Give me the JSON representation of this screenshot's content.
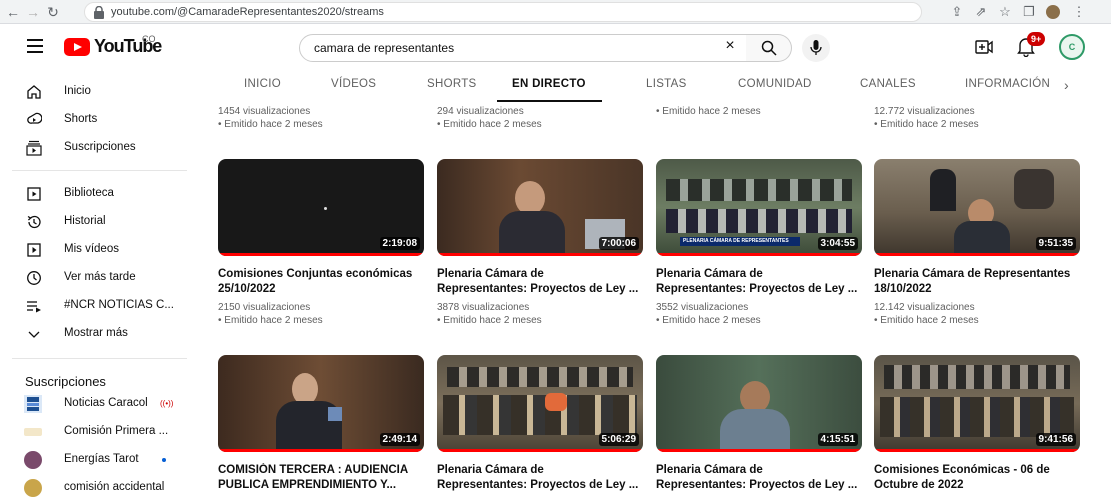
{
  "browser": {
    "url": "youtube.com/@CamaradeRepresentantes2020/streams"
  },
  "header": {
    "logo_text": "YouTube",
    "country_code": "CO",
    "search_value": "camara de representantes",
    "notification_count": "9+",
    "avatar_text": "C"
  },
  "sidebar": {
    "items": [
      {
        "label": "Inicio",
        "icon": "home-icon"
      },
      {
        "label": "Shorts",
        "icon": "shorts-icon"
      },
      {
        "label": "Suscripciones",
        "icon": "subscriptions-icon"
      },
      {
        "label": "Biblioteca",
        "icon": "library-icon"
      },
      {
        "label": "Historial",
        "icon": "history-icon"
      },
      {
        "label": "Mis vídeos",
        "icon": "my-videos-icon"
      },
      {
        "label": "Ver más tarde",
        "icon": "watch-later-icon"
      },
      {
        "label": "#NCR NOTICIAS C...",
        "icon": "playlist-icon"
      },
      {
        "label": "Mostrar más",
        "icon": "chevron-down-icon"
      }
    ],
    "subscriptions_heading": "Suscripciones",
    "subscriptions": [
      {
        "label": "Noticias Caracol",
        "live": "((•))"
      },
      {
        "label": "Comisión Primera ..."
      },
      {
        "label": "Energías Tarot"
      },
      {
        "label": "comisión accidental"
      }
    ]
  },
  "tabs": [
    "INICIO",
    "VÍDEOS",
    "SHORTS",
    "EN DIRECTO",
    "LISTAS",
    "COMUNIDAD",
    "CANALES",
    "INFORMACIÓN"
  ],
  "partial_row": [
    {
      "views": "1454 visualizaciones",
      "date": "• Emitido hace 2 meses"
    },
    {
      "views": "294 visualizaciones",
      "date": "• Emitido hace 2 meses"
    },
    {
      "views": "",
      "date": "• Emitido hace 2 meses"
    },
    {
      "views": "12.772 visualizaciones",
      "date": "• Emitido hace 2 meses"
    }
  ],
  "videos_row1": [
    {
      "title1": "Comisiones Conjuntas económicas",
      "title2": "25/10/2022",
      "views": "2150 visualizaciones",
      "date": "• Emitido hace 2 meses",
      "duration": "2:19:08"
    },
    {
      "title1": "Plenaria Cámara de",
      "title2": "Representantes: Proyectos de Ley ...",
      "views": "3878 visualizaciones",
      "date": "• Emitido hace 2 meses",
      "duration": "7:00:06"
    },
    {
      "title1": "Plenaria Cámara de",
      "title2": "Representantes: Proyectos de Ley ...",
      "views": "3552 visualizaciones",
      "date": "• Emitido hace 2 meses",
      "duration": "3:04:55",
      "banner": "PLENARIA CÁMARA DE REPRESENTANTES"
    },
    {
      "title1": "Plenaria Cámara de Representantes",
      "title2": "18/10/2022",
      "views": "12.142 visualizaciones",
      "date": "• Emitido hace 2 meses",
      "duration": "9:51:35"
    }
  ],
  "videos_row2": [
    {
      "title1": "COMISIÓN TERCERA : AUDIENCIA",
      "title2": "PUBLICA EMPRENDIMIENTO Y...",
      "duration": "2:49:14"
    },
    {
      "title1": "Plenaria Cámara de",
      "title2": "Representantes: Proyectos de Ley ...",
      "duration": "5:06:29"
    },
    {
      "title1": "Plenaria Cámara de",
      "title2": "Representantes: Proyectos de Ley ...",
      "duration": "4:15:51"
    },
    {
      "title1": "Comisiones Económicas - 06 de",
      "title2": "Octubre de 2022",
      "duration": "9:41:56"
    }
  ]
}
